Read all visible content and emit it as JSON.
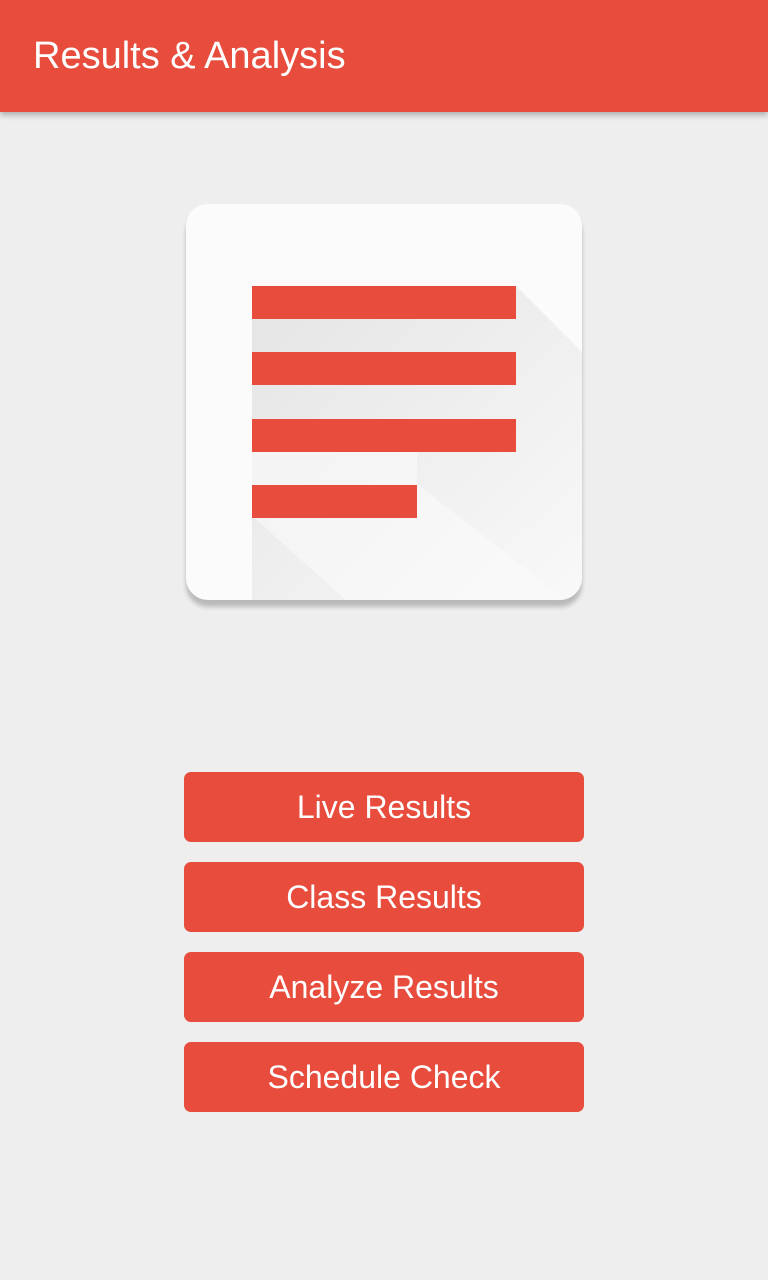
{
  "app_bar": {
    "title": "Results & Analysis",
    "color": "#e74c3c"
  },
  "logo": {
    "icon": "document-lines-icon",
    "line_color": "#e74c3c",
    "card_color": "#fbfbfb"
  },
  "buttons": [
    {
      "label": "Live Results"
    },
    {
      "label": "Class Results"
    },
    {
      "label": "Analyze Results"
    },
    {
      "label": "Schedule Check"
    }
  ],
  "colors": {
    "accent": "#e74c3c",
    "background": "#eeeeee",
    "text_on_accent": "#ffffff"
  }
}
